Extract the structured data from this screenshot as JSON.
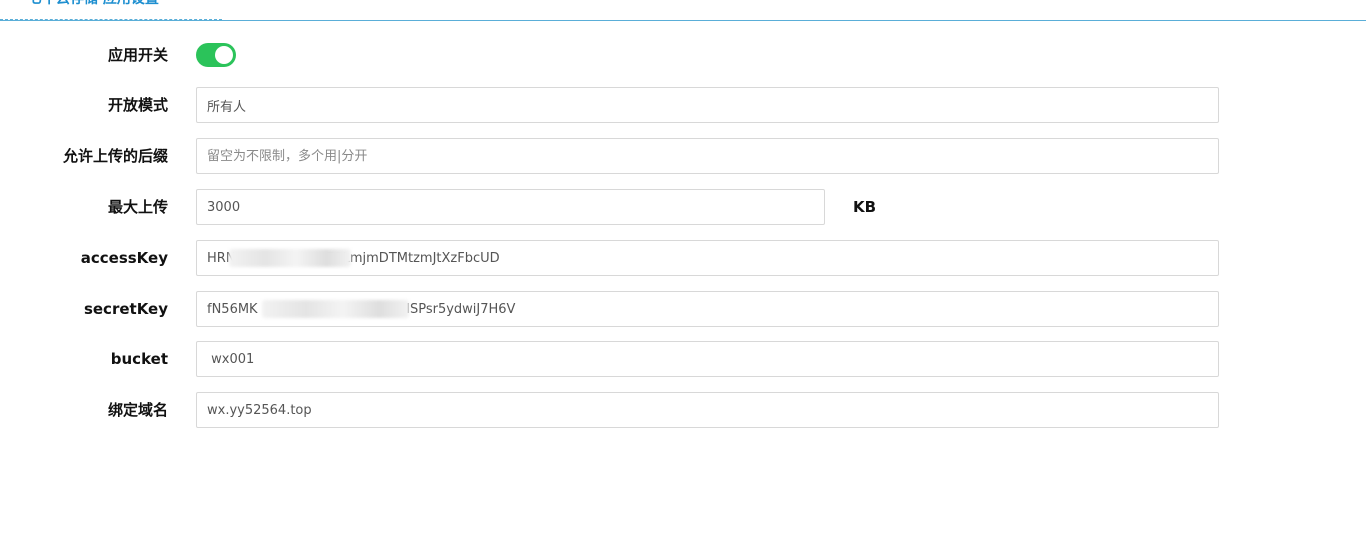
{
  "header": {
    "title": "七牛云存储 应用设置"
  },
  "form": {
    "app_switch": {
      "label": "应用开关",
      "enabled": true,
      "color": "#2bc35a"
    },
    "open_mode": {
      "label": "开放模式",
      "value": "所有人"
    },
    "allowed_suffix": {
      "label": "允许上传的后缀",
      "value": "",
      "placeholder": "留空为不限制，多个用|分开"
    },
    "max_upload": {
      "label": "最大上传",
      "value": "3000",
      "unit": "KB"
    },
    "access_key": {
      "label": "accessKey",
      "value": "HRN                    aE3LmjmDTMtzmJtXzFbcUD"
    },
    "secret_key": {
      "label": "secretKey",
      "value": "fN56MK                                    lSPsr5ydwiJ7H6V"
    },
    "bucket": {
      "label": "bucket",
      "value": " wx001"
    },
    "domain": {
      "label": "绑定域名",
      "value": "wx.yy52564.top"
    }
  },
  "colors": {
    "accent": "#1e8fd0",
    "toggle_on": "#2bc35a",
    "input_border": "#d8d8d8"
  }
}
